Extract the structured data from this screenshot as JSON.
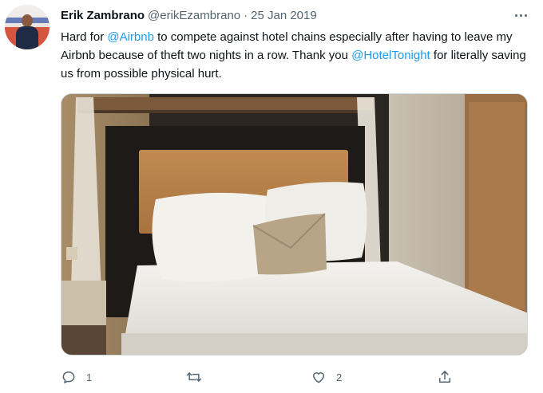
{
  "tweet": {
    "author_name": "Erik Zambrano",
    "handle": "@erikEzambrano",
    "separator": "·",
    "date": "25 Jan 2019",
    "text": {
      "p1": "Hard for ",
      "m1": "@Airbnb",
      "p2": " to compete against hotel chains especially after having to leave my Airbnb because of theft two nights in a row. Thank you ",
      "m2": "@HotelTonight",
      "p3": " for literally saving us from possible physical hurt."
    },
    "media_icon": "hotel-bed-photo"
  },
  "actions": {
    "reply_count": "1",
    "retweet_count": "",
    "like_count": "2",
    "share_count": ""
  },
  "colors": {
    "accent": "#1d9bf0",
    "secondary_text": "#536471",
    "primary_text": "#0f1419"
  }
}
